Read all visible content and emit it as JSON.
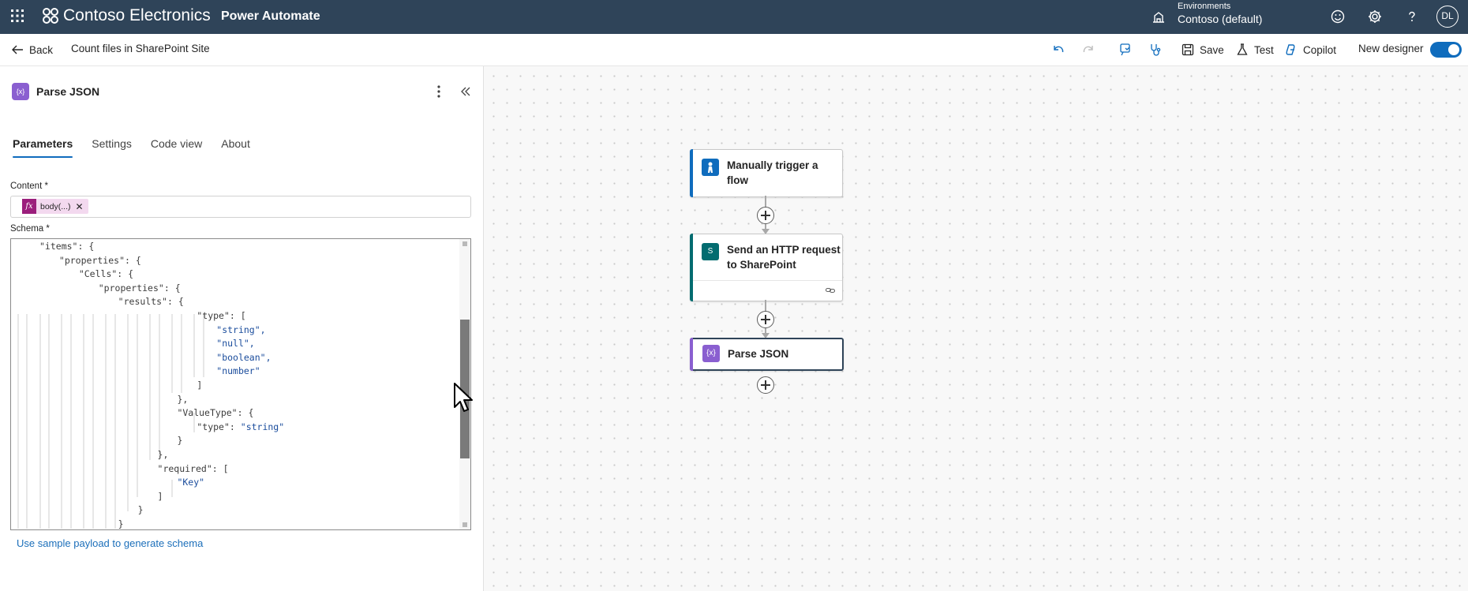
{
  "topbar": {
    "brand": "Contoso Electronics",
    "product": "Power Automate",
    "environment_label": "Environments",
    "environment_name": "Contoso (default)",
    "avatar_initials": "DL",
    "color": "#2f4459"
  },
  "commandbar": {
    "back_label": "Back",
    "flow_name": "Count files in SharePoint Site",
    "save_label": "Save",
    "test_label": "Test",
    "copilot_label": "Copilot",
    "new_designer_label": "New designer",
    "new_designer_on": true
  },
  "panel": {
    "title": "Parse JSON",
    "tabs": [
      {
        "label": "Parameters",
        "active": true
      },
      {
        "label": "Settings",
        "active": false
      },
      {
        "label": "Code view",
        "active": false
      },
      {
        "label": "About",
        "active": false
      }
    ],
    "content_label": "Content *",
    "content_token": "body(...)",
    "content_token_icon": "fx",
    "schema_label": "Schema *",
    "schema_lines": [
      {
        "ind": 0,
        "t": "\"items\": {"
      },
      {
        "ind": 1,
        "t": "\"properties\": {"
      },
      {
        "ind": 2,
        "t": "\"Cells\": {"
      },
      {
        "ind": 3,
        "t": "\"properties\": {"
      },
      {
        "ind": 4,
        "t": "\"results\": {"
      },
      {
        "ind": 8,
        "t": "\"type\": ["
      },
      {
        "ind": 9,
        "t": "\"string\","
      },
      {
        "ind": 9,
        "t": "\"null\","
      },
      {
        "ind": 9,
        "t": "\"boolean\","
      },
      {
        "ind": 9,
        "t": "\"number\""
      },
      {
        "ind": 8,
        "t": "]"
      },
      {
        "ind": 7,
        "t": "},"
      },
      {
        "ind": 7,
        "t": "\"ValueType\": {"
      },
      {
        "ind": 8,
        "t": "\"type\": \"string\""
      },
      {
        "ind": 7,
        "t": "}"
      },
      {
        "ind": 6,
        "t": "},"
      },
      {
        "ind": 6,
        "t": "\"required\": ["
      },
      {
        "ind": 7,
        "t": "\"Key\""
      },
      {
        "ind": 6,
        "t": "]"
      },
      {
        "ind": 5,
        "t": "}"
      },
      {
        "ind": 4,
        "t": "}"
      }
    ],
    "sample_link": "Use sample payload to generate schema"
  },
  "flow": {
    "nodes": [
      {
        "title": "Manually trigger a flow",
        "line1": "Manually trigger a",
        "line2": "flow",
        "color": "#0f6cbd"
      },
      {
        "title": "Send an HTTP request to SharePoint",
        "line1": "Send an HTTP request",
        "line2": "to SharePoint",
        "color": "#036c70"
      },
      {
        "title": "Parse JSON",
        "line1": "Parse JSON",
        "line2": "",
        "color": "#8a5fd0",
        "selected": true
      }
    ]
  }
}
